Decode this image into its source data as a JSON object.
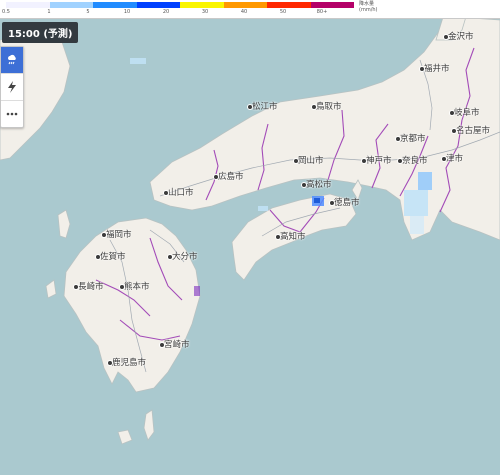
{
  "legend": {
    "ticks": [
      "0.5",
      "1",
      "5",
      "10",
      "20",
      "30",
      "40",
      "50",
      "80+"
    ],
    "unit_line1": "降水量",
    "unit_line2": "(mm/h)",
    "colors": [
      "#f2f2ff",
      "#a0d2ff",
      "#218cff",
      "#0041ff",
      "#faf500",
      "#ff9900",
      "#ff2800",
      "#b40068"
    ]
  },
  "time_label": "15:00 (予測)",
  "toolbar": {
    "rain_icon": "cloud-rain-icon",
    "lightning_icon": "lightning-icon",
    "more_icon": "more-dots-icon"
  },
  "cities": {
    "kanazawa": "金沢市",
    "fukui": "福井市",
    "matsue": "松江市",
    "tottori": "鳥取市",
    "gifu": "岐阜市",
    "nagoya": "名古屋市",
    "kyoto": "京都市",
    "okayama": "岡山市",
    "hiroshima": "広島市",
    "yamaguchi": "山口市",
    "kobe": "神戸市",
    "nara": "奈良市",
    "tsu": "津市",
    "takamatsu": "高松市",
    "tokushima": "徳島市",
    "kochi": "高知市",
    "fukuoka": "福岡市",
    "saga": "佐賀市",
    "oita": "大分市",
    "nagasaki": "長崎市",
    "kumamoto": "熊本市",
    "miyazaki": "宮崎市",
    "kagoshima": "鹿児島市"
  }
}
